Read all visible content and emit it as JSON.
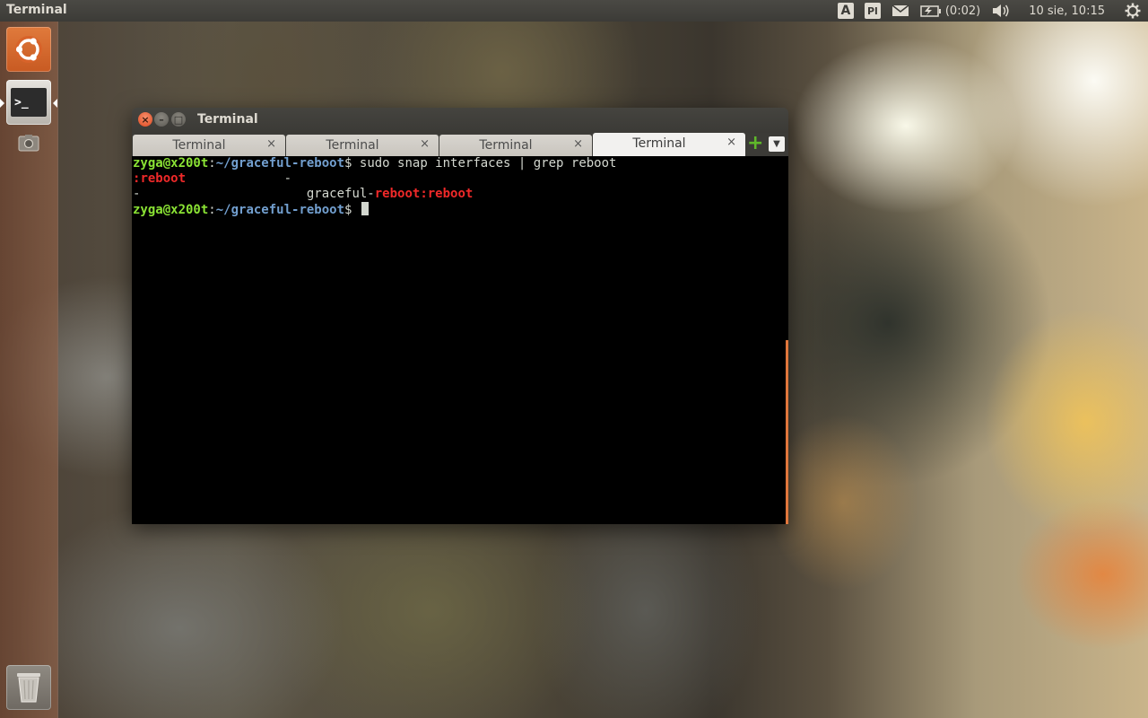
{
  "panel": {
    "app_title": "Terminal",
    "keyboard_layout_a": "A",
    "keyboard_layout_pl": "Pl",
    "battery_text": "(0:02)",
    "clock": "10 sie, 10:15"
  },
  "launcher": {
    "items": [
      "dash",
      "terminal",
      "screenshot",
      "trash"
    ]
  },
  "window": {
    "title": "Terminal",
    "close_glyph": "×",
    "min_glyph": "–",
    "max_glyph": "□",
    "tabs": [
      {
        "label": "Terminal",
        "close": "×"
      },
      {
        "label": "Terminal",
        "close": "×"
      },
      {
        "label": "Terminal",
        "close": "×"
      },
      {
        "label": "Terminal",
        "close": "×"
      }
    ],
    "add_tab_glyph": "+",
    "tab_menu_glyph": "▼"
  },
  "terminal": {
    "prompt_user": "zyga@x200t",
    "prompt_sep": ":",
    "prompt_path": "~/graceful-reboot",
    "prompt_end": "$ ",
    "command": "sudo snap interfaces | grep reboot",
    "out1_colon": ":",
    "out1_red": "reboot",
    "out1_rest": "             -",
    "out2_dash": "-",
    "out2_pad": "                      ",
    "out2_plain": "graceful-",
    "out2_red1": "reboot",
    "out2_colon": ":",
    "out2_red2": "reboot"
  },
  "colors": {
    "prompt_user": "#8ae234",
    "prompt_path": "#729fcf",
    "match_highlight": "#ef2929",
    "launcher_accent": "#e0763c"
  }
}
